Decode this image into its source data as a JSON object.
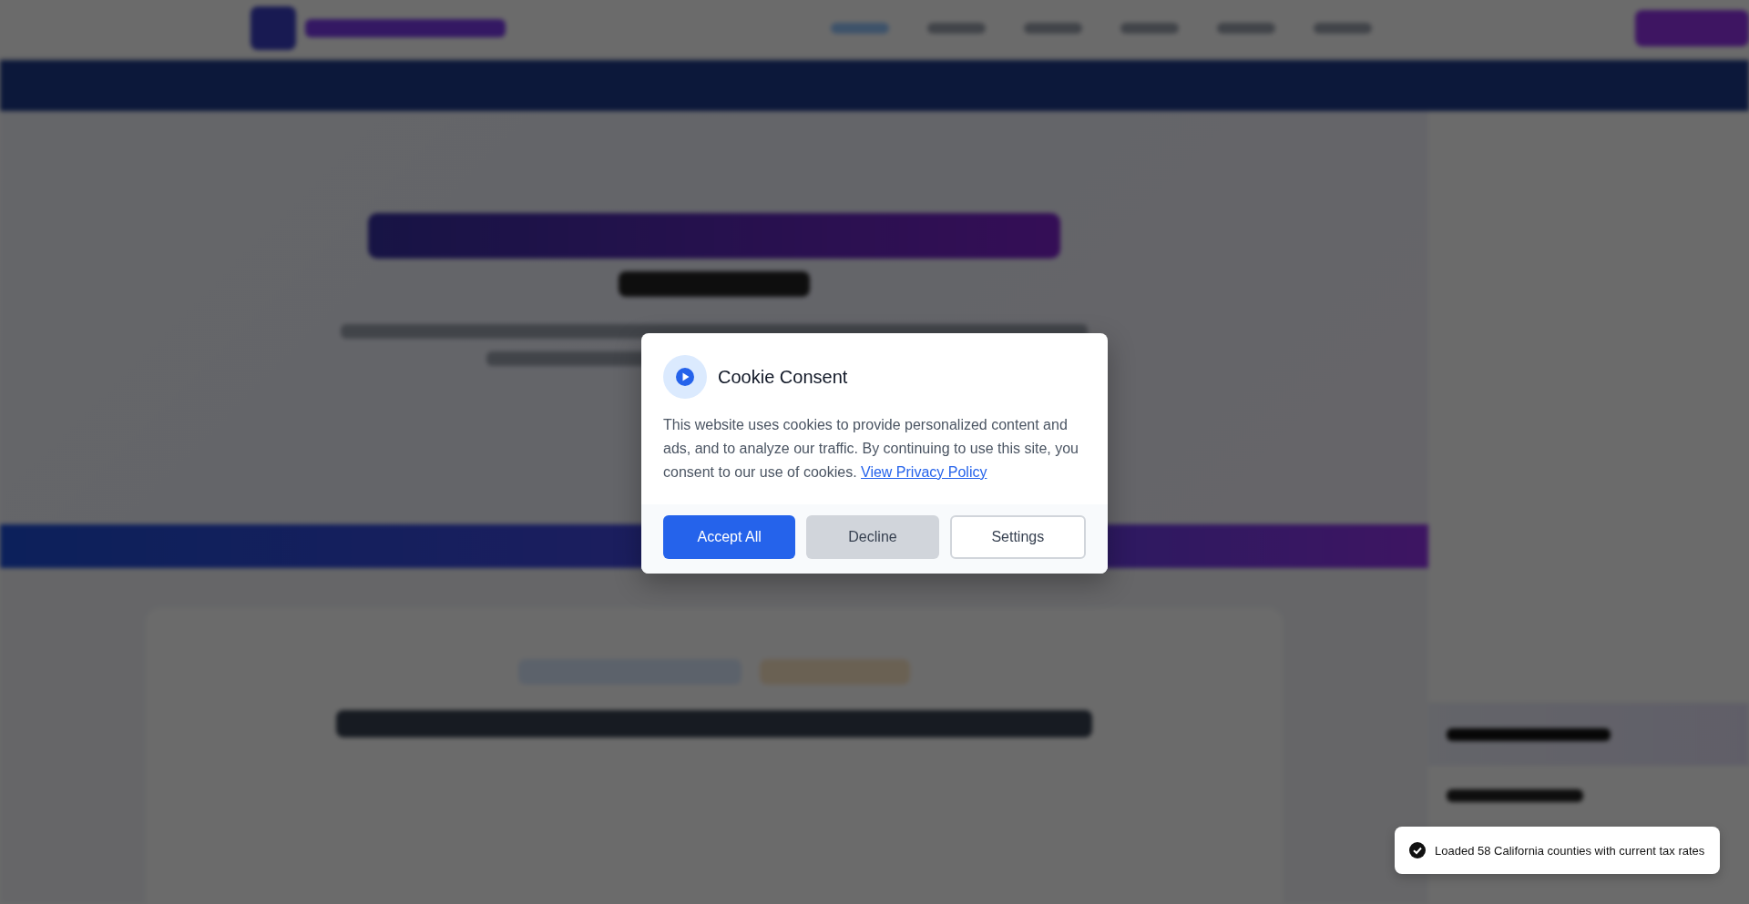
{
  "cookie_dialog": {
    "title": "Cookie Consent",
    "message": "This website uses cookies to provide personalized content and ads, and to analyze our traffic. By continuing to use this site, you consent to our use of cookies.",
    "link": "View Privacy Policy",
    "buttons": [
      {
        "label": "Accept All",
        "kind": "primary"
      },
      {
        "label": "Decline",
        "kind": "secondary"
      },
      {
        "label": "Settings",
        "kind": "outline"
      }
    ]
  },
  "toast": {
    "message": "Loaded 58 California counties with current tax rates"
  }
}
